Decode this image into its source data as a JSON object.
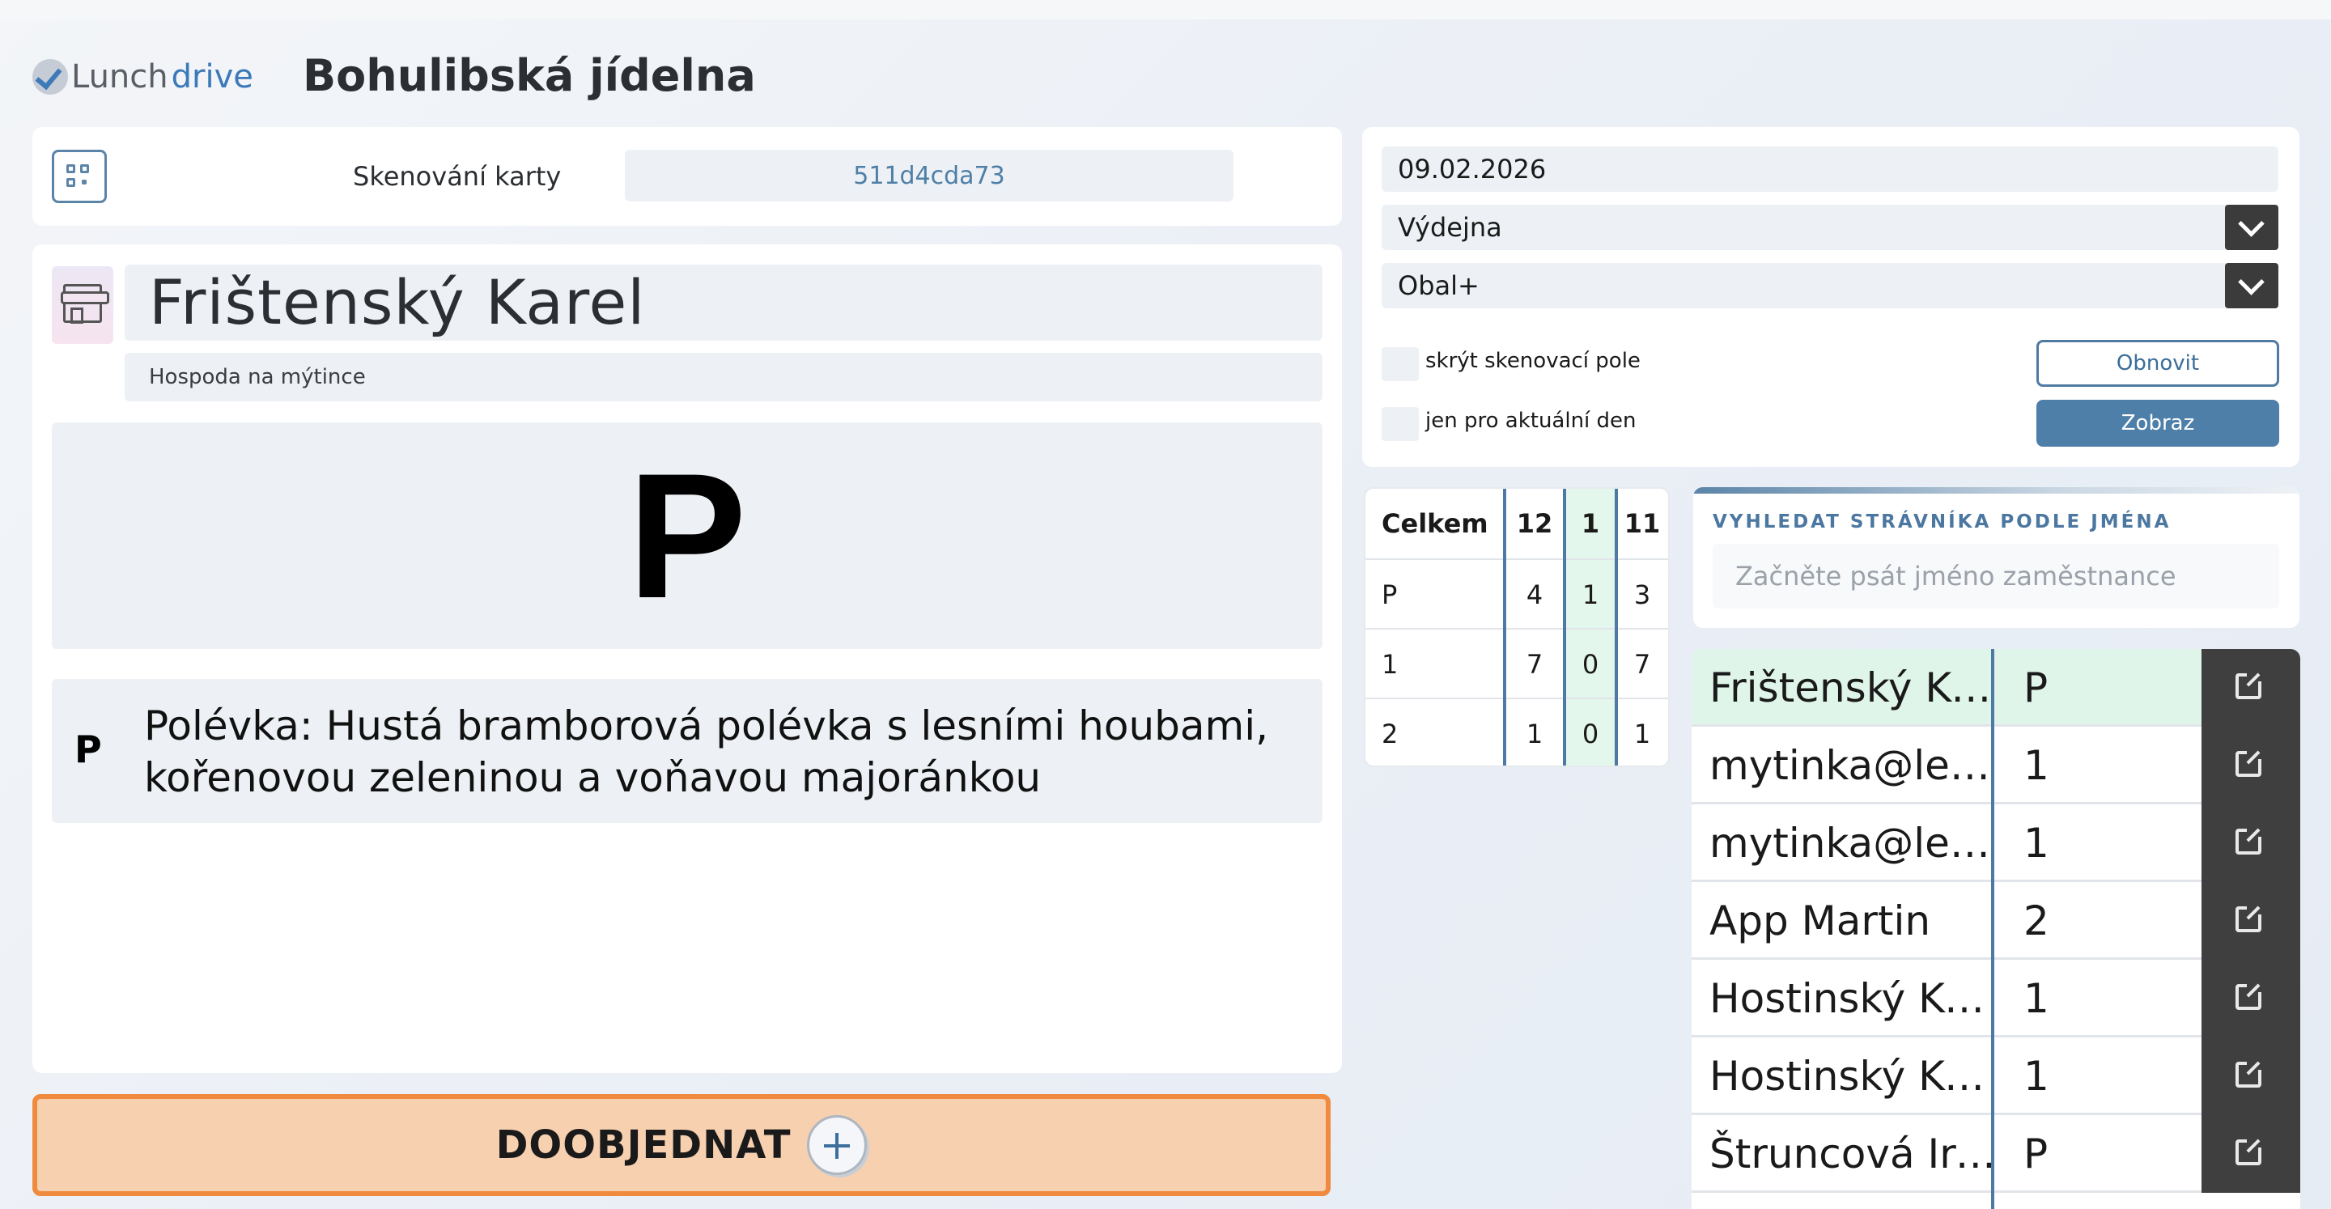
{
  "header": {
    "logo_part1": "Lunch",
    "logo_part2": "drive",
    "title": "Bohulibská jídelna"
  },
  "scan": {
    "label": "Skenování karty",
    "value": "511d4cda73"
  },
  "person": {
    "name": "Frištenský Karel",
    "location": "Hospoda na mýtince",
    "meal_code_large": "P",
    "meal_code": "P",
    "meal_description": "Polévka: Hustá bramborová polévka s lesními houbami, kořenovou zeleninou a voňavou majoránkou"
  },
  "order_button": {
    "label": "DOOBJEDNAT"
  },
  "filters": {
    "date": "09.02.2026",
    "place": "Výdejna",
    "packaging": "Obal+",
    "hide_scan_label": "skrýt skenovací pole",
    "today_only_label": "jen pro aktuální den",
    "refresh_label": "Obnovit",
    "show_label": "Zobraz"
  },
  "summary": {
    "header": [
      "Celkem",
      "12",
      "1",
      "11"
    ],
    "rows": [
      [
        "P",
        "4",
        "1",
        "3"
      ],
      [
        "1",
        "7",
        "0",
        "7"
      ],
      [
        "2",
        "1",
        "0",
        "1"
      ]
    ]
  },
  "search": {
    "label": "VYHLEDAT STRÁVNÍKA PODLE JMÉNA",
    "placeholder": "Začněte psát jméno zaměstnance"
  },
  "diners": [
    {
      "name": "Frištenský Karel",
      "code": "P",
      "selected": true
    },
    {
      "name": "mytinka@lesni.cz",
      "code": "1",
      "selected": false
    },
    {
      "name": "mytinka@lesni.cz",
      "code": "1",
      "selected": false
    },
    {
      "name": "App Martin",
      "code": "2",
      "selected": false
    },
    {
      "name": "Hostinský Karel",
      "code": "1",
      "selected": false
    },
    {
      "name": "Hostinský Karel",
      "code": "1",
      "selected": false
    },
    {
      "name": "Štruncová Irena",
      "code": "P",
      "selected": false
    }
  ],
  "colors": {
    "accent": "#4d7fa8",
    "order_bg": "#f7d0b0",
    "order_border": "#ef8a3e",
    "selected_row": "#dff5ea",
    "link_bg": "#3f3f3f"
  },
  "icons": {
    "logo": "check-circle-icon",
    "scan": "qr-code-icon",
    "avatar": "shop-icon",
    "add": "plus-circle-icon",
    "dropdown": "chevron-down-icon",
    "open": "external-link-icon"
  }
}
